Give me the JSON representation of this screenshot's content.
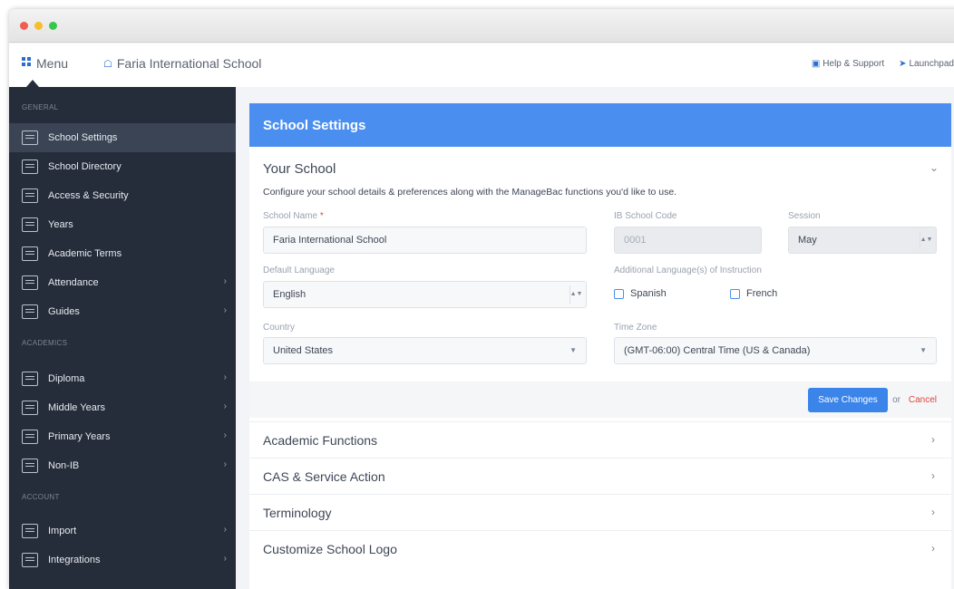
{
  "window": {
    "dots": [
      "close",
      "minimize",
      "maximize"
    ]
  },
  "topnav": {
    "menu_icon": "grid-icon",
    "menu_label": "Menu",
    "school_icon": "home-icon",
    "school_name": "Faria International School",
    "help_label": "Help & Support",
    "launchpad_label": "Launchpad"
  },
  "sidebar": {
    "sections": [
      {
        "header": "GENERAL"
      },
      {
        "header": "ACADEMICS"
      },
      {
        "header": "ACCOUNT"
      }
    ],
    "items": [
      {
        "label": "School Settings",
        "icon": "building-icon",
        "active": true
      },
      {
        "label": "School Directory",
        "icon": "people-icon"
      },
      {
        "label": "Access & Security",
        "icon": "lock-icon"
      },
      {
        "label": "Years",
        "icon": "list-icon"
      },
      {
        "label": "Academic Terms",
        "icon": "calendar-icon"
      },
      {
        "label": "Attendance",
        "icon": "attendance-icon",
        "has_submenu": true
      },
      {
        "label": "Guides",
        "icon": "book-icon",
        "has_submenu": true
      },
      {
        "label": "Diploma",
        "icon": "diploma-icon",
        "has_submenu": true
      },
      {
        "label": "Middle Years",
        "icon": "middle-years-icon",
        "has_submenu": true
      },
      {
        "label": "Primary Years",
        "icon": "primary-years-icon",
        "has_submenu": true
      },
      {
        "label": "Non-IB",
        "icon": "non-ib-icon",
        "has_submenu": true
      },
      {
        "label": "Import",
        "icon": "import-icon",
        "has_submenu": true
      },
      {
        "label": "Integrations",
        "icon": "integrations-icon",
        "has_submenu": true
      }
    ]
  },
  "settings": {
    "header_title": "School Settings",
    "section_title": "Your School",
    "description": "Configure your school details & preferences along with the ManageBac functions you'd like to use.",
    "school_name_label": "School Name",
    "school_name_value": "Faria International School",
    "ib_code_label": "IB School Code",
    "ib_code_value": "0001",
    "session_label": "Session",
    "session_value": "May",
    "default_language_label": "Default Language",
    "default_language_value": "English",
    "additional_languages_label": "Additional Language(s) of Instruction",
    "language_options": [
      "Spanish",
      "French"
    ],
    "country_label": "Country",
    "country_value": "United States",
    "timezone_label": "Time Zone",
    "timezone_value": "(GMT-06:00) Central Time (US & Canada)",
    "save_label": "Save Changes",
    "or_label": "or",
    "cancel_label": "Cancel"
  },
  "accordion": [
    {
      "label": "Academic Functions"
    },
    {
      "label": "CAS & Service Action"
    },
    {
      "label": "Terminology"
    },
    {
      "label": "Customize School Logo"
    }
  ],
  "colors": {
    "sidebar_bg": "#252c3a",
    "header_blue": "#4a8ff0",
    "save_button": "#3a84ea",
    "cancel_red": "#e0463c"
  }
}
